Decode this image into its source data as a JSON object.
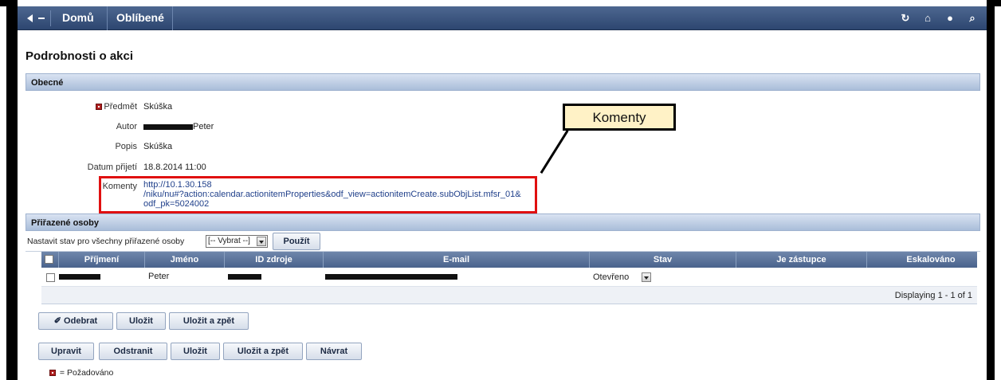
{
  "nav": {
    "items": [
      "Domů",
      "Oblíbené"
    ],
    "icons": [
      "refresh-icon",
      "home-icon",
      "help-icon",
      "search-icon"
    ]
  },
  "page": {
    "title": "Podrobnosti o akci"
  },
  "general": {
    "section_title": "Obecné",
    "fields": {
      "subject": {
        "label": "Předmět",
        "value": "Skúška"
      },
      "author": {
        "label": "Autor",
        "value": "Peter"
      },
      "description": {
        "label": "Popis",
        "value": "Skúška"
      },
      "received": {
        "label": "Datum přijetí",
        "value": "18.8.2014 11:00"
      },
      "comments": {
        "label": "Komenty",
        "lines": [
          "http://10.1.30.158",
          "/niku/nu#?action:calendar.actionitemProperties&odf_view=actionitemCreate.subObjList.mfsr_01&",
          "odf_pk=5024002"
        ]
      }
    }
  },
  "annotation": {
    "callout": "Komenty",
    "highlight_color": "#e01010"
  },
  "assigned": {
    "section_title": "Přiřazené osoby",
    "set_all_label": "Nastavit stav pro všechny přiřazené osoby",
    "set_all_select": "[-- Vybrat --]",
    "apply_button": "Použít",
    "columns": [
      "Příjmení",
      "Jméno",
      "ID zdroje",
      "E-mail",
      "Stav",
      "Je zástupce",
      "Eskalováno"
    ],
    "rows": [
      {
        "first_name": "Peter",
        "status": "Otevřeno"
      }
    ],
    "footer": "Displaying 1 - 1 of 1"
  },
  "table_buttons": {
    "remove": "Odebrat",
    "save": "Uložit",
    "save_back": "Uložit a zpět"
  },
  "page_buttons": {
    "edit": "Upravit",
    "delete": "Odstranit",
    "save": "Uložit",
    "save_back": "Uložit a zpět",
    "return": "Návrat"
  },
  "legend": {
    "text": "= Požadováno"
  }
}
